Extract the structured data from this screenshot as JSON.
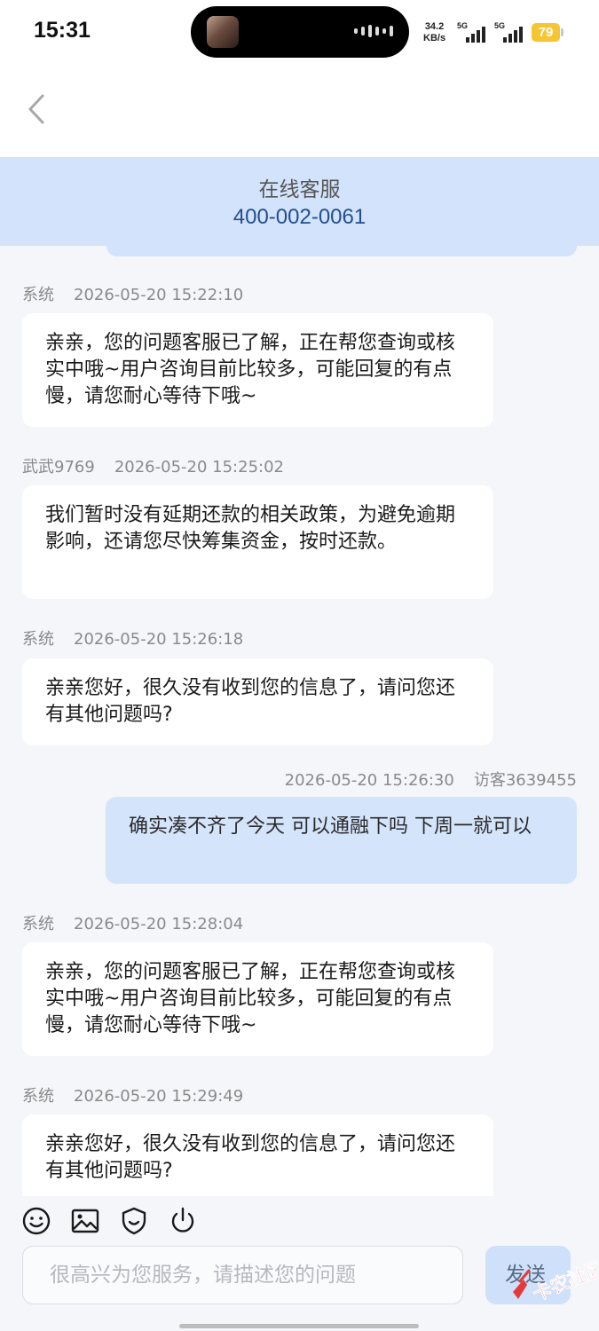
{
  "status_bar": {
    "time": "15:31",
    "net_speed_value": "34.2",
    "net_speed_unit": "KB/s",
    "signal1_label": "5G",
    "signal2_label": "5G",
    "battery": "79"
  },
  "header": {
    "title": "在线客服",
    "phone": "400-002-0061"
  },
  "messages": [
    {
      "side": "left",
      "sender": "系统",
      "time": "2026-05-20 15:22:10",
      "text": "亲亲，您的问题客服已了解，正在帮您查询或核实中哦~用户咨询目前比较多，可能回复的有点慢，请您耐心等待下哦~"
    },
    {
      "side": "left",
      "sender": "武武9769",
      "time": "2026-05-20 15:25:02",
      "text": "我们暂时没有延期还款的相关政策，为避免逾期影响，还请您尽快筹集资金，按时还款。"
    },
    {
      "side": "left",
      "sender": "系统",
      "time": "2026-05-20 15:26:18",
      "text": "亲亲您好，很久没有收到您的信息了，请问您还有其他问题吗?"
    },
    {
      "side": "right",
      "sender": "访客3639455",
      "time": "2026-05-20 15:26:30",
      "text": "确实凑不齐了今天 可以通融下吗 下周一就可以"
    },
    {
      "side": "left",
      "sender": "系统",
      "time": "2026-05-20 15:28:04",
      "text": "亲亲，您的问题客服已了解，正在帮您查询或核实中哦~用户咨询目前比较多，可能回复的有点慢，请您耐心等待下哦~"
    },
    {
      "side": "left",
      "sender": "系统",
      "time": "2026-05-20 15:29:49",
      "text": "亲亲您好，很久没有收到您的信息了，请问您还有其他问题吗?"
    }
  ],
  "toolbar": {
    "icons": [
      "emoji-icon",
      "image-icon",
      "shield-icon",
      "power-icon"
    ]
  },
  "input": {
    "placeholder": "很高兴为您服务，请描述您的问题",
    "value": ""
  },
  "send_label": "发送",
  "watermark_text": "卡农社区"
}
